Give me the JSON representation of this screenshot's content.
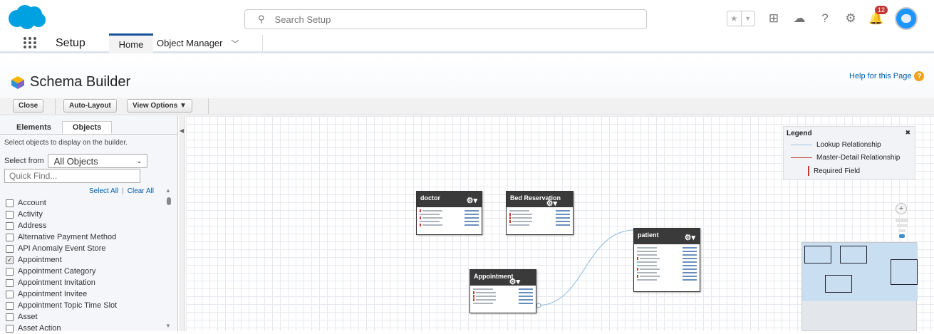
{
  "search": {
    "placeholder": "Search Setup"
  },
  "topbar": {
    "notification_count": "12"
  },
  "nav": {
    "app_name": "Setup",
    "tab_home": "Home",
    "tab_object_manager": "Object Manager"
  },
  "header": {
    "title": "Schema Builder",
    "help_link": "Help for this Page"
  },
  "toolbar": {
    "close": "Close",
    "auto_layout": "Auto-Layout",
    "view_options": "View Options ▼"
  },
  "panel": {
    "tabs": [
      "Elements",
      "Objects"
    ],
    "active_tab": "Objects",
    "description": "Select objects to display on the builder.",
    "select_from_label": "Select from",
    "select_from_value": "All Objects",
    "quick_find_placeholder": "Quick Find...",
    "select_all": "Select All",
    "clear_all": "Clear All",
    "objects": [
      {
        "label": "Account",
        "checked": false
      },
      {
        "label": "Activity",
        "checked": false
      },
      {
        "label": "Address",
        "checked": false
      },
      {
        "label": "Alternative Payment Method",
        "checked": false
      },
      {
        "label": "API Anomaly Event Store",
        "checked": false
      },
      {
        "label": "Appointment",
        "checked": true
      },
      {
        "label": "Appointment Category",
        "checked": false
      },
      {
        "label": "Appointment Invitation",
        "checked": false
      },
      {
        "label": "Appointment Invitee",
        "checked": false
      },
      {
        "label": "Appointment Topic Time Slot",
        "checked": false
      },
      {
        "label": "Asset",
        "checked": false
      },
      {
        "label": "Asset Action",
        "checked": false
      }
    ]
  },
  "canvas": {
    "objects": {
      "doctor": "doctor",
      "bed_reservation": "Bed Reservation",
      "patient": "patient",
      "appointment": "Appointment"
    }
  },
  "legend": {
    "title": "Legend",
    "lookup": "Lookup Relationship",
    "master_detail": "Master-Detail Relationship",
    "required": "Required Field"
  },
  "colors": {
    "brand_blue": "#00a1e0",
    "link_blue": "#015ba7",
    "required_red": "#c23934",
    "header_dark": "#3a3a3a"
  }
}
